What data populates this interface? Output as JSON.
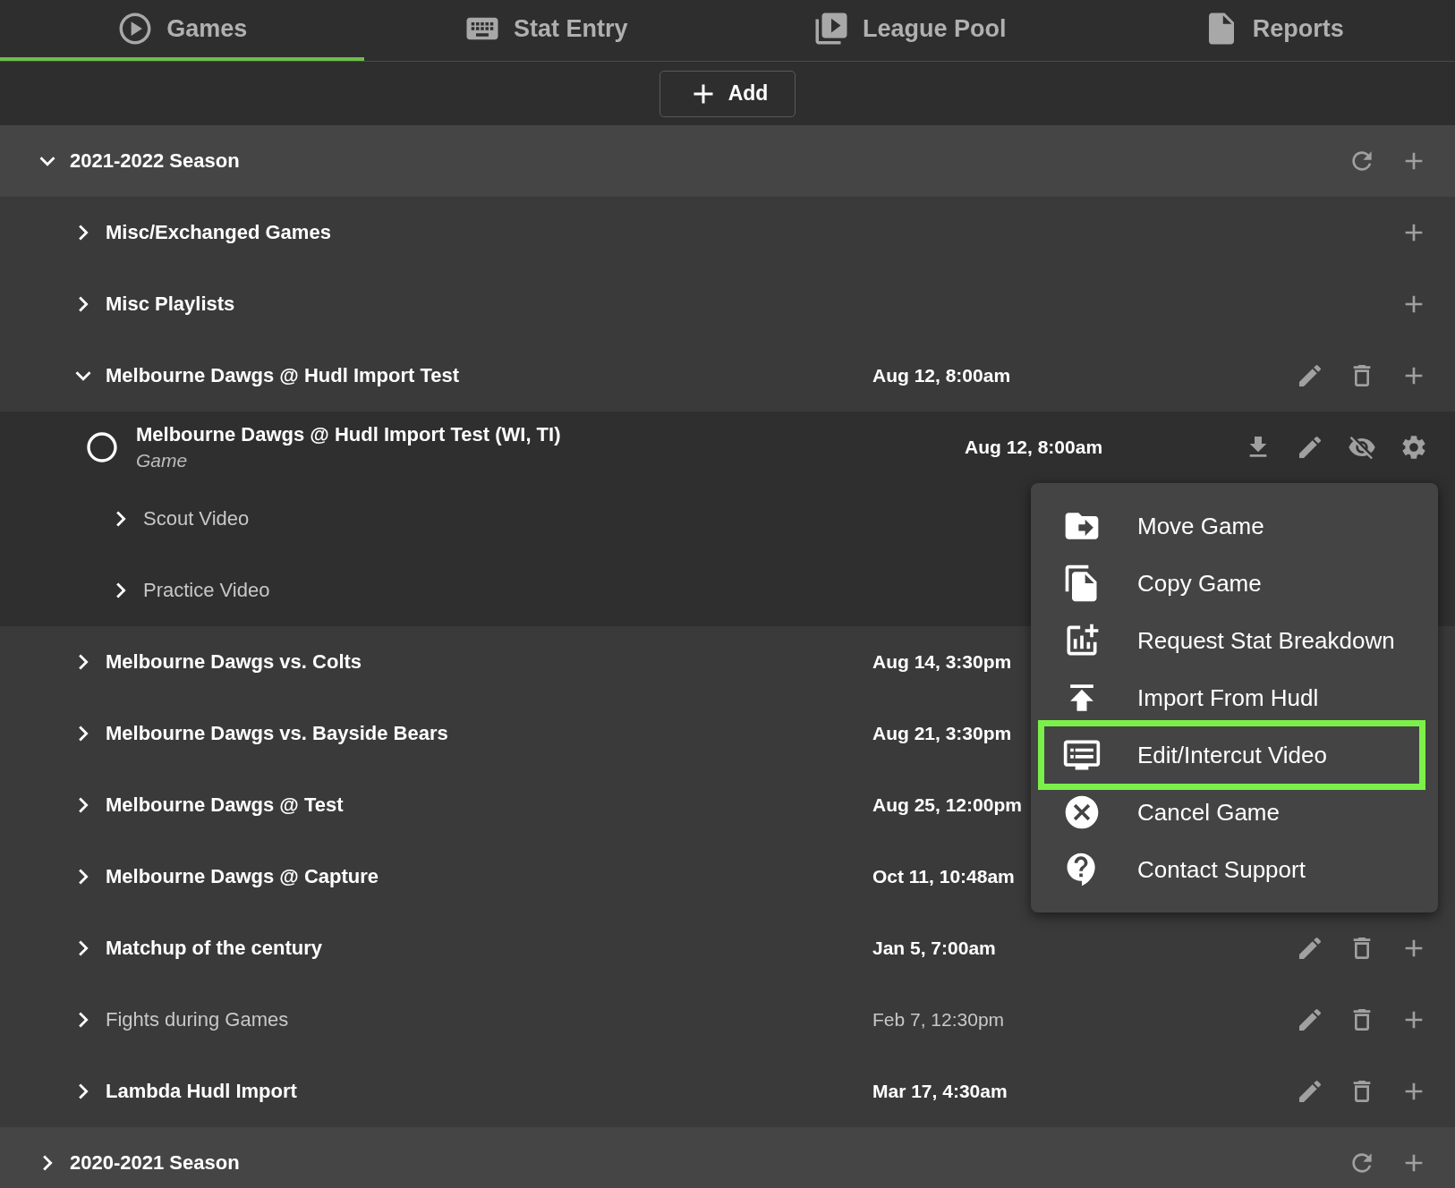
{
  "tabs": [
    {
      "kind": "games",
      "label": "Games",
      "selected": true
    },
    {
      "kind": "stat",
      "label": "Stat Entry",
      "selected": false
    },
    {
      "kind": "pool",
      "label": "League Pool",
      "selected": false
    },
    {
      "kind": "reports",
      "label": "Reports",
      "selected": false
    }
  ],
  "add_button": {
    "label": "Add"
  },
  "seasons": [
    {
      "title": "2021-2022 Season",
      "expanded": true,
      "actions": [
        {
          "kind": "refresh"
        },
        {
          "kind": "add"
        }
      ],
      "children": [
        {
          "title": "Misc/Exchanged Games",
          "expanded": false,
          "muted": false,
          "actions": [
            {
              "kind": "add"
            }
          ]
        },
        {
          "title": "Misc Playlists",
          "expanded": false,
          "muted": false,
          "actions": [
            {
              "kind": "add"
            }
          ]
        },
        {
          "title": "Melbourne Dawgs @ Hudl Import Test",
          "date": "Aug 12, 8:00am",
          "expanded": true,
          "muted": false,
          "actions": [
            {
              "kind": "edit"
            },
            {
              "kind": "delete"
            },
            {
              "kind": "add"
            }
          ],
          "children": [
            {
              "kind": "game",
              "title": "Melbourne Dawgs @ Hudl Import Test (WI, TI)",
              "subtitle": "Game",
              "date": "Aug 12, 8:00am",
              "selected": false,
              "actions": [
                {
                  "kind": "download"
                },
                {
                  "kind": "edit"
                },
                {
                  "kind": "hide"
                },
                {
                  "kind": "settings"
                }
              ]
            },
            {
              "kind": "folder",
              "title": "Scout Video",
              "expanded": false
            },
            {
              "kind": "folder",
              "title": "Practice Video",
              "expanded": false
            }
          ]
        },
        {
          "title": "Melbourne Dawgs vs. Colts",
          "date": "Aug 14, 3:30pm",
          "expanded": false,
          "muted": false
        },
        {
          "title": "Melbourne Dawgs vs. Bayside Bears",
          "date": "Aug 21, 3:30pm",
          "expanded": false,
          "muted": false
        },
        {
          "title": "Melbourne Dawgs @ Test",
          "date": "Aug 25, 12:00pm",
          "expanded": false,
          "muted": false
        },
        {
          "title": "Melbourne Dawgs @ Capture",
          "date": "Oct 11, 10:48am",
          "expanded": false,
          "muted": false
        },
        {
          "title": "Matchup of the century",
          "date": "Jan 5, 7:00am",
          "expanded": false,
          "muted": false,
          "actions": [
            {
              "kind": "edit"
            },
            {
              "kind": "delete"
            },
            {
              "kind": "add"
            }
          ]
        },
        {
          "title": "Fights during Games",
          "date": "Feb 7, 12:30pm",
          "expanded": false,
          "muted": true,
          "actions": [
            {
              "kind": "edit"
            },
            {
              "kind": "delete"
            },
            {
              "kind": "add"
            }
          ]
        },
        {
          "title": "Lambda Hudl Import",
          "date": "Mar 17, 4:30am",
          "expanded": false,
          "muted": false,
          "actions": [
            {
              "kind": "edit"
            },
            {
              "kind": "delete"
            },
            {
              "kind": "add"
            }
          ]
        }
      ]
    },
    {
      "title": "2020-2021 Season",
      "expanded": false,
      "actions": [
        {
          "kind": "refresh"
        },
        {
          "kind": "add"
        }
      ]
    }
  ],
  "menu": {
    "items": [
      {
        "kind": "move",
        "label": "Move Game",
        "highlighted": false
      },
      {
        "kind": "copy",
        "label": "Copy Game",
        "highlighted": false
      },
      {
        "kind": "request",
        "label": "Request Stat Breakdown",
        "highlighted": false
      },
      {
        "kind": "import",
        "label": "Import From Hudl",
        "highlighted": false
      },
      {
        "kind": "intercut",
        "label": "Edit/Intercut Video",
        "highlighted": true
      },
      {
        "kind": "cancel",
        "label": "Cancel Game",
        "highlighted": false
      },
      {
        "kind": "support",
        "label": "Contact Support",
        "highlighted": false
      }
    ]
  }
}
